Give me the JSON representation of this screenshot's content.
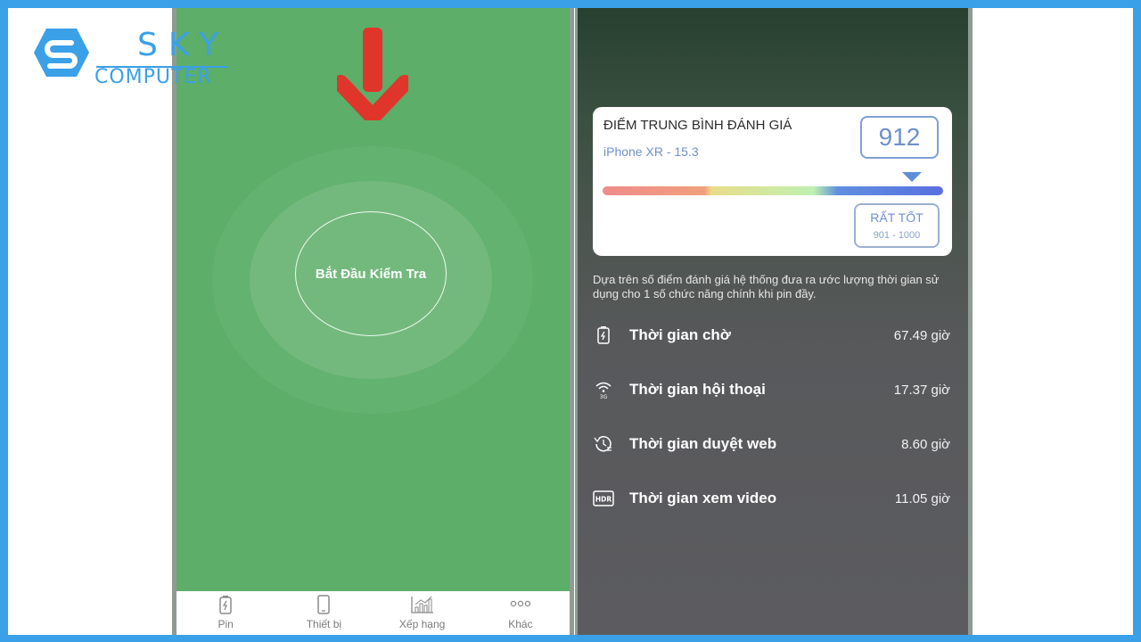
{
  "left_screen": {
    "start_button_label": "Bắt Đầu Kiểm Tra",
    "tabs": [
      {
        "label": "Pin",
        "icon": "battery-icon"
      },
      {
        "label": "Thiết bị",
        "icon": "phone-icon"
      },
      {
        "label": "Xếp hạng",
        "icon": "chart-icon"
      },
      {
        "label": "Khác",
        "icon": "more-icon"
      }
    ]
  },
  "right_screen": {
    "card": {
      "title": "ĐIỂM TRUNG BÌNH ĐÁNH GIÁ",
      "device": "iPhone XR - 15.3",
      "score": "912",
      "rating_label": "RẤT TỐT",
      "rating_range": "901 - 1000"
    },
    "description": "Dựa trên số điểm đánh giá hệ thống đưa ra ước lượng thời gian sử dụng cho 1 số chức năng chính khi pin đầy.",
    "stats": [
      {
        "label": "Thời gian chờ",
        "value": "67.49 giờ",
        "icon": "battery-charge-icon"
      },
      {
        "label": "Thời gian hội thoại",
        "value": "17.37 giờ",
        "icon": "signal-3g-icon"
      },
      {
        "label": "Thời gian duyệt web",
        "value": "8.60 giờ",
        "icon": "history-icon"
      },
      {
        "label": "Thời gian xem video",
        "value": "11.05 giờ",
        "icon": "hdr-icon"
      }
    ]
  },
  "colors": {
    "frame": "#3aa0e8",
    "left_bg": "#5cae68",
    "arrow": "#e0352b",
    "accent_blue": "#6e90cc"
  }
}
